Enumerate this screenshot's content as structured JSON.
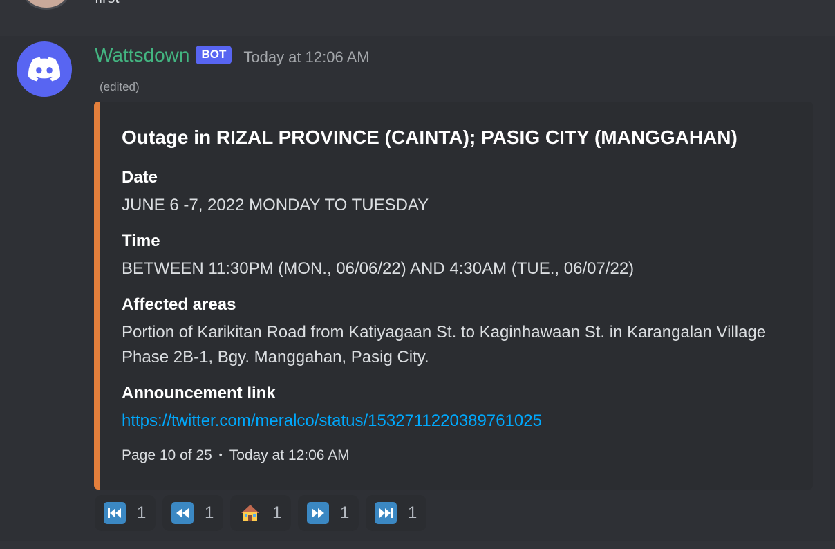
{
  "previous_message": {
    "text": "first"
  },
  "message": {
    "username": "Wattsdown",
    "bot_tag": "BOT",
    "timestamp": "Today at 12:06 AM",
    "edited": "(edited)"
  },
  "embed": {
    "title": "Outage in RIZAL PROVINCE (CAINTA); PASIG CITY (MANGGAHAN)",
    "accent_color": "#e37f3c",
    "fields": [
      {
        "name": "Date",
        "value": "JUNE 6 -7, 2022 MONDAY TO TUESDAY"
      },
      {
        "name": "Time",
        "value": "BETWEEN 11:30PM (MON., 06/06/22) AND 4:30AM (TUE., 06/07/22)"
      },
      {
        "name": "Affected areas",
        "value": "Portion of Karikitan Road from Katiyagaan St. to Kaginhawaan St. in Karangalan Village Phase 2B-1, Bgy. Manggahan, Pasig City."
      },
      {
        "name": "Announcement link",
        "value": "https://twitter.com/meralco/status/1532711220389761025"
      }
    ],
    "footer": {
      "page": "Page 10 of 25",
      "separator": "•",
      "timestamp": "Today at 12:06 AM"
    }
  },
  "reactions": [
    {
      "icon": "first-page-icon",
      "count": "1"
    },
    {
      "icon": "previous-page-icon",
      "count": "1"
    },
    {
      "icon": "house-icon",
      "count": "1"
    },
    {
      "icon": "next-page-icon",
      "count": "1"
    },
    {
      "icon": "last-page-icon",
      "count": "1"
    }
  ],
  "colors": {
    "username": "#43b581",
    "bot_tag": "#5865f2",
    "link": "#00a8fc",
    "reaction_emoji": "#3b88c3"
  }
}
